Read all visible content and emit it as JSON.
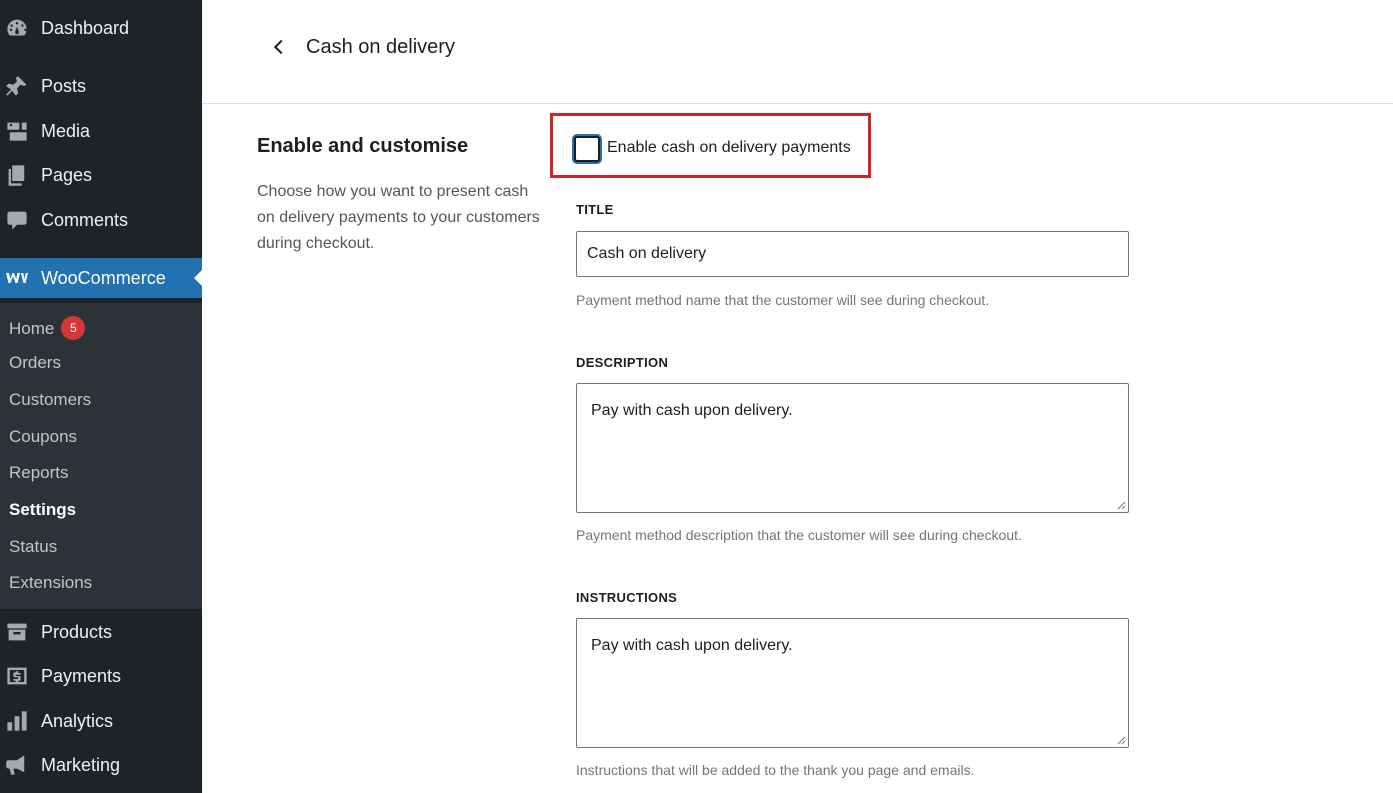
{
  "sidebar": {
    "top_items": [
      {
        "label": "Dashboard",
        "icon": "dashboard-icon"
      },
      {
        "label": "Posts",
        "icon": "pin-icon"
      },
      {
        "label": "Media",
        "icon": "media-icon"
      },
      {
        "label": "Pages",
        "icon": "pages-icon"
      },
      {
        "label": "Comments",
        "icon": "comment-icon"
      }
    ],
    "woocommerce": {
      "label": "WooCommerce",
      "icon": "woocommerce-icon"
    },
    "submenu": [
      {
        "label": "Home",
        "badge": "5"
      },
      {
        "label": "Orders"
      },
      {
        "label": "Customers"
      },
      {
        "label": "Coupons"
      },
      {
        "label": "Reports"
      },
      {
        "label": "Settings"
      },
      {
        "label": "Status"
      },
      {
        "label": "Extensions"
      }
    ],
    "bottom_items": [
      {
        "label": "Products",
        "icon": "archive-icon"
      },
      {
        "label": "Payments",
        "icon": "payment-icon"
      },
      {
        "label": "Analytics",
        "icon": "bar-chart-icon"
      },
      {
        "label": "Marketing",
        "icon": "megaphone-icon"
      }
    ],
    "colors": {
      "background": "#1d2327",
      "submenu_bg": "#2c3338",
      "active": "#2271b1",
      "badge": "#d63638"
    }
  },
  "header": {
    "title": "Cash on delivery"
  },
  "section": {
    "heading": "Enable and customise",
    "description": "Choose how you want to present cash on delivery payments to your customers during checkout."
  },
  "enable": {
    "label": "Enable cash on delivery payments",
    "checked": false,
    "highlight_color": "#d0242b"
  },
  "fields": {
    "title": {
      "label": "TITLE",
      "value": "Cash on delivery",
      "help": "Payment method name that the customer will see during checkout."
    },
    "description": {
      "label": "DESCRIPTION",
      "value": "Pay with cash upon delivery.",
      "help": "Payment method description that the customer will see during checkout."
    },
    "instructions": {
      "label": "INSTRUCTIONS",
      "value": "Pay with cash upon delivery.",
      "help": "Instructions that will be added to the thank you page and emails."
    }
  }
}
